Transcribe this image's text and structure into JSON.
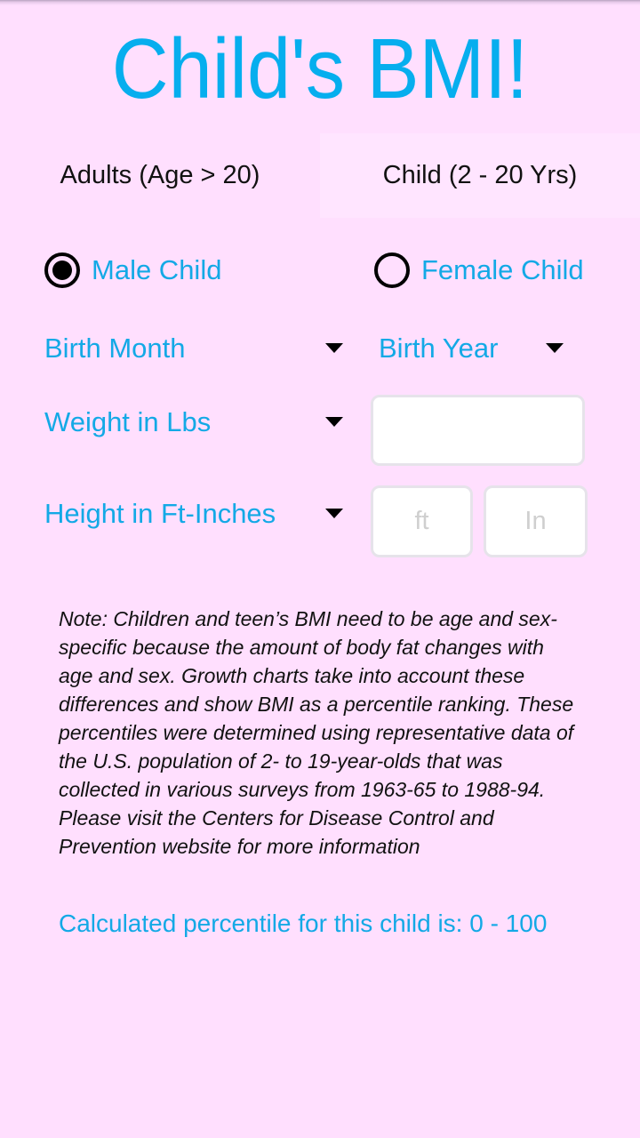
{
  "app": {
    "title": "Child's BMI!"
  },
  "colors": {
    "background": "#ffdffe",
    "accent": "#06aeee",
    "label_blue": "#13a9e6",
    "selected_tab_bg": "#ffe5ff"
  },
  "tabs": [
    {
      "label": "Adults (Age > 20)",
      "selected": false
    },
    {
      "label": "Child (2 - 20 Yrs)",
      "selected": true
    }
  ],
  "gender": {
    "options": [
      {
        "label": "Male Child",
        "checked": true
      },
      {
        "label": "Female Child",
        "checked": false
      }
    ]
  },
  "birth": {
    "month_label": "Birth Month",
    "year_label": "Birth Year"
  },
  "weight": {
    "unit_label": "Weight in Lbs",
    "value": "",
    "placeholder": ""
  },
  "height": {
    "unit_label": "Height in Ft-Inches",
    "feet_value": "",
    "feet_placeholder": "ft",
    "inches_value": "",
    "inches_placeholder": "In"
  },
  "note": "Note: Children and teen’s BMI need to be age and sex-specific because the amount of body fat changes with age and sex. Growth charts take into account these differences and show BMI as a percentile ranking. These percentiles were determined using representative data of the U.S. population of 2- to 19-year-olds that was collected in various surveys from 1963-65 to 1988-94. Please visit the Centers for Disease Control and Prevention website for more information",
  "result": {
    "text": "Calculated percentile for this child is: 0 - 100"
  }
}
